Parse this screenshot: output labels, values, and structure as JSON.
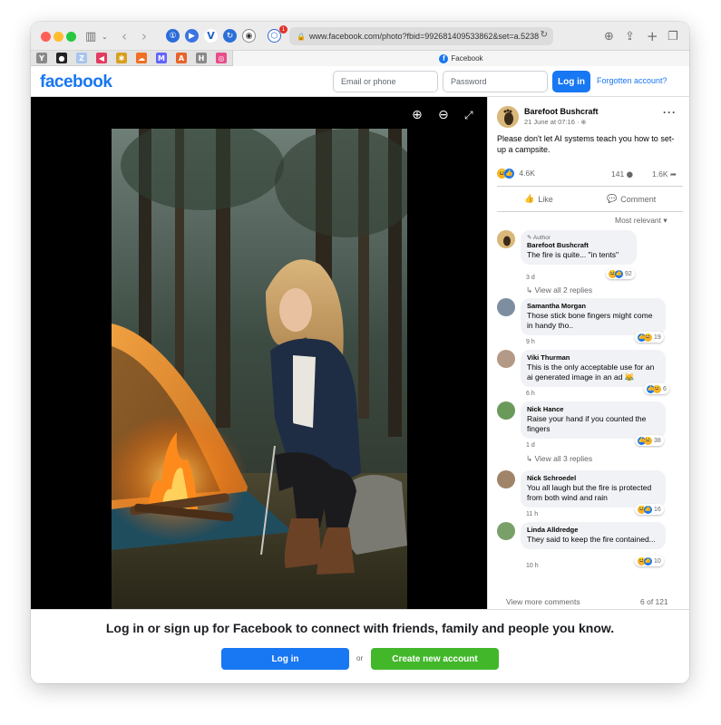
{
  "browser": {
    "url": "www.facebook.com/photo?fbid=992681409533862&set=a.5238",
    "tab_title": "Facebook",
    "extension_badge": "1",
    "pinned_tabs": [
      {
        "icon": "y-icon",
        "glyph": "Y",
        "color": "#8a8a8a"
      },
      {
        "icon": "github-icon",
        "glyph": "●",
        "color": "#222222"
      },
      {
        "icon": "translate-icon",
        "glyph": "Z",
        "color": "#a9c4ee"
      },
      {
        "icon": "send-icon",
        "glyph": "◀",
        "color": "#e23b61"
      },
      {
        "icon": "colorful-icon",
        "glyph": "✱",
        "color": "#d8a020"
      },
      {
        "icon": "soundcloud-icon",
        "glyph": "☁",
        "color": "#f26f23"
      },
      {
        "icon": "mastodon-icon",
        "glyph": "M",
        "color": "#6364ff"
      },
      {
        "icon": "a-icon",
        "glyph": "A",
        "color": "#e8642c"
      },
      {
        "icon": "h-icon",
        "glyph": "H",
        "color": "#8a8a8a"
      },
      {
        "icon": "dribbble-icon",
        "glyph": "◎",
        "color": "#ea4c89"
      }
    ]
  },
  "header": {
    "logo": "facebook",
    "email_placeholder": "Email or phone",
    "password_placeholder": "Password",
    "login_label": "Log in",
    "forgot_label": "Forgotten account?"
  },
  "post": {
    "author": "Barefoot Bushcraft",
    "time": "21 June at 07:16 · ",
    "text": "Please don't let AI systems teach you how to set-up a campsite.",
    "reactions_count": "4.6K",
    "comments_count": "141",
    "shares_count": "1.6K",
    "like_label": "Like",
    "comment_label": "Comment",
    "sort_label": "Most relevant"
  },
  "comments": [
    {
      "author_tag": "Author",
      "name": "Barefoot Bushcraft",
      "text": "The fire is quite... \"in tents\"",
      "time": "3 d",
      "reacts": "92",
      "replies": "View all 2 replies"
    },
    {
      "name": "Samantha Morgan",
      "text": "Those stick bone fingers might come in handy tho..",
      "time": "9 h",
      "reacts": "19"
    },
    {
      "name": "Viki Thurman",
      "text": "This is the only acceptable use for an ai generated image in an ad 😹",
      "time": "6 h",
      "reacts": "6"
    },
    {
      "name": "Nick Hance",
      "text": "Raise your hand if you counted the fingers",
      "time": "1 d",
      "reacts": "38",
      "replies": "View all 3 replies"
    },
    {
      "name": "Nick Schroedel",
      "text": "You all laugh but the fire is protected from both wind and rain",
      "time": "11 h",
      "reacts": "16"
    },
    {
      "name": "Linda Alldredge",
      "text": "They said to keep the fire contained...",
      "time": "10 h",
      "reacts": "10"
    }
  ],
  "footer_comments": {
    "view_more": "View more comments",
    "count": "6 of 121"
  },
  "banner": {
    "text": "Log in or sign up for Facebook to connect with friends, family and people you know.",
    "login_label": "Log in",
    "or_label": "or",
    "create_label": "Create new account"
  },
  "colors": {
    "brand_blue": "#1877f2",
    "create_green": "#42b72a"
  }
}
